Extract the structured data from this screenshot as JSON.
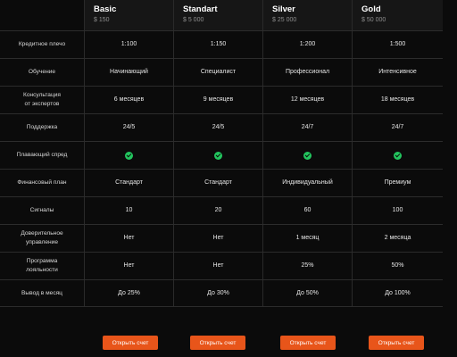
{
  "plans": [
    {
      "name": "Basic",
      "price": "$ 150"
    },
    {
      "name": "Standart",
      "price": "$ 5 000"
    },
    {
      "name": "Silver",
      "price": "$ 25 000"
    },
    {
      "name": "Gold",
      "price": "$ 50 000"
    }
  ],
  "rows": [
    {
      "label": "Кредитное плечо",
      "values": [
        "1:100",
        "1:150",
        "1:200",
        "1:500"
      ]
    },
    {
      "label": "Обучение",
      "values": [
        "Начинающий",
        "Специалист",
        "Профессионал",
        "Интенсивное"
      ]
    },
    {
      "label": "Консультация\nот экспертов",
      "values": [
        "6 месяцев",
        "9 месяцев",
        "12 месяцев",
        "18 месяцев"
      ]
    },
    {
      "label": "Поддержка",
      "values": [
        "24/5",
        "24/5",
        "24/7",
        "24/7"
      ]
    },
    {
      "label": "Плавающий спред",
      "values": [
        "check",
        "check",
        "check",
        "check"
      ]
    },
    {
      "label": "Финансовый план",
      "values": [
        "Стандарт",
        "Стандарт",
        "Индивидуальный",
        "Премиум"
      ]
    },
    {
      "label": "Сигналы",
      "values": [
        "10",
        "20",
        "60",
        "100"
      ]
    },
    {
      "label": "Доверительное\nуправление",
      "values": [
        "Нет",
        "Нет",
        "1 месяц",
        "2 месяца"
      ]
    },
    {
      "label": "Программа\nлояльности",
      "values": [
        "Нет",
        "Нет",
        "25%",
        "50%"
      ]
    },
    {
      "label": "Вывод в месяц",
      "values": [
        "До 25%",
        "До 30%",
        "До 50%",
        "До 100%"
      ]
    }
  ],
  "cta_label": "Открыть счет",
  "colors": {
    "background": "#0b0b0b",
    "accent": "#e8551a",
    "check": "#22c55e"
  }
}
